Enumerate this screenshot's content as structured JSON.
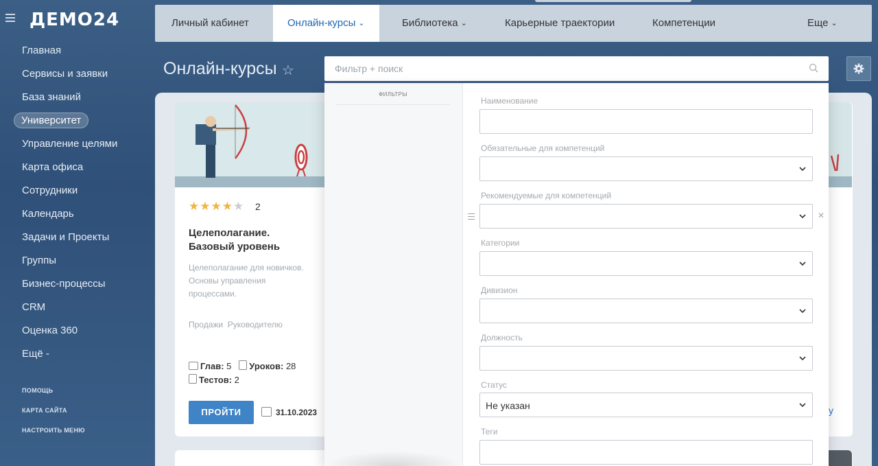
{
  "app": {
    "logo": "ДЕМО24"
  },
  "sidebar": {
    "items": [
      {
        "label": "Главная"
      },
      {
        "label": "Сервисы и заявки"
      },
      {
        "label": "База знаний"
      },
      {
        "label": "Университет",
        "active": true
      },
      {
        "label": "Управление целями"
      },
      {
        "label": "Карта офиса"
      },
      {
        "label": "Сотрудники"
      },
      {
        "label": "Календарь"
      },
      {
        "label": "Задачи и Проекты"
      },
      {
        "label": "Группы"
      },
      {
        "label": "Бизнес-процессы"
      },
      {
        "label": "CRM"
      },
      {
        "label": "Оценка 360"
      },
      {
        "label": "Ещё -"
      }
    ],
    "footer_links": [
      "ПОМОЩЬ",
      "КАРТА САЙТА",
      "НАСТРОИТЬ МЕНЮ"
    ]
  },
  "topnav": {
    "items": [
      {
        "label": "Личный кабинет"
      },
      {
        "label": "Онлайн-курсы",
        "active": true,
        "dropdown": true
      },
      {
        "label": "Библиотека",
        "dropdown": true
      },
      {
        "label": "Карьерные траектории"
      },
      {
        "label": "Компетенции"
      },
      {
        "label": "Еще",
        "dropdown": true
      }
    ]
  },
  "page": {
    "title": "Онлайн-курсы",
    "search_placeholder": "Фильтр + поиск"
  },
  "course": {
    "rating_stars": 4,
    "rating_max": 5,
    "rating_count": "2",
    "title_line1": "Целеполагание.",
    "title_line2": "Базовый уровень",
    "description": "Целеполагание для новичков. Основы управления процессами.",
    "tag1": "Продажи",
    "tag2": "Руководителю",
    "chapters_label": "Глав:",
    "chapters_value": "5",
    "lessons_label": "Уроков:",
    "lessons_value": "28",
    "tests_label": "Тестов:",
    "tests_value": "2",
    "go_button": "ПРОЙТИ",
    "date": "31.10.2023",
    "right_link_fragment": "у"
  },
  "filter_popup": {
    "sidebar_title": "ФИЛЬТРЫ",
    "fields": [
      {
        "label": "Наименование",
        "type": "text",
        "value": ""
      },
      {
        "label": "Обязательные для компетенций",
        "type": "select",
        "value": ""
      },
      {
        "label": "Рекомендуемые для компетенций",
        "type": "select",
        "value": ""
      },
      {
        "label": "Категории",
        "type": "select",
        "value": ""
      },
      {
        "label": "Дивизион",
        "type": "select",
        "value": ""
      },
      {
        "label": "Должность",
        "type": "select",
        "value": ""
      },
      {
        "label": "Статус",
        "type": "select",
        "value": "Не указан"
      },
      {
        "label": "Теги",
        "type": "text",
        "value": ""
      }
    ]
  },
  "colors": {
    "accent": "#2067b0",
    "button": "#3f84c6",
    "star": "#f1b53f",
    "sidebar_bg": "#2f5078"
  }
}
